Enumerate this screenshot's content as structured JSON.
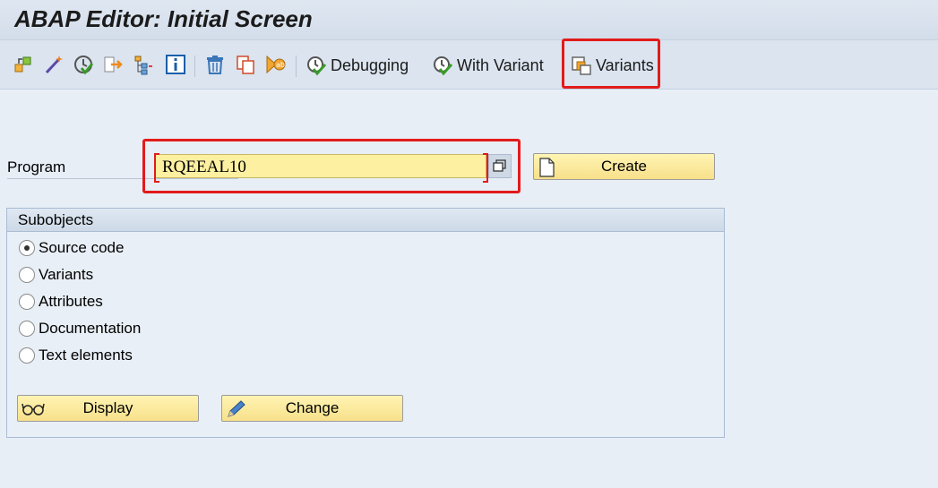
{
  "window": {
    "title": "ABAP Editor: Initial Screen"
  },
  "toolbar": {
    "icons": [
      "other-object-icon",
      "wizard-icon",
      "check-icon",
      "where-used-icon",
      "object-hierarchy-icon",
      "info-icon",
      "delete-icon",
      "copy-icon",
      "rename-icon"
    ],
    "debugging_label": "Debugging",
    "with_variant_label": "With Variant",
    "variants_label": "Variants"
  },
  "program": {
    "label": "Program",
    "value": "RQEEAL10"
  },
  "buttons": {
    "create": "Create",
    "display": "Display",
    "change": "Change"
  },
  "subobjects": {
    "title": "Subobjects",
    "options": [
      {
        "label": "Source code",
        "selected": true
      },
      {
        "label": "Variants",
        "selected": false
      },
      {
        "label": "Attributes",
        "selected": false
      },
      {
        "label": "Documentation",
        "selected": false
      },
      {
        "label": "Text elements",
        "selected": false
      }
    ]
  },
  "colors": {
    "highlight": "#e21b1b",
    "input_bg": "#fdf0a0",
    "button_bg": "#f7e08a"
  }
}
